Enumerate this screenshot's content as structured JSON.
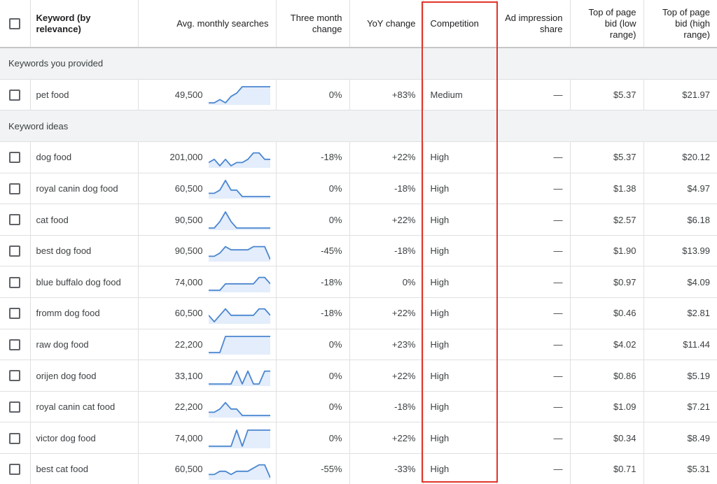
{
  "headers": {
    "keyword": "Keyword (by relevance)",
    "avg": "Avg. monthly searches",
    "three_month": [
      "Three month",
      "change"
    ],
    "yoy": "YoY change",
    "competition": "Competition",
    "impression": [
      "Ad impression",
      "share"
    ],
    "low_bid": [
      "Top of page",
      "bid (low",
      "range)"
    ],
    "high_bid": [
      "Top of page",
      "bid (high",
      "range)"
    ]
  },
  "sections": {
    "provided": "Keywords you provided",
    "ideas": "Keyword ideas"
  },
  "rows": [
    {
      "keyword": "pet food",
      "avg": "49,500",
      "three": "0%",
      "yoy": "+83%",
      "comp": "Medium",
      "imp": "—",
      "low": "$5.37",
      "high": "$21.97",
      "trend": [
        1,
        1,
        2,
        1,
        3,
        4,
        6,
        6,
        6,
        6,
        6,
        6
      ]
    },
    {
      "keyword": "dog food",
      "avg": "201,000",
      "three": "-18%",
      "yoy": "+22%",
      "comp": "High",
      "imp": "—",
      "low": "$5.37",
      "high": "$20.12",
      "trend": [
        2,
        3,
        1,
        3,
        1,
        2,
        2,
        3,
        5,
        5,
        3,
        3
      ]
    },
    {
      "keyword": "royal canin dog food",
      "avg": "60,500",
      "three": "0%",
      "yoy": "-18%",
      "comp": "High",
      "imp": "—",
      "low": "$1.38",
      "high": "$4.97",
      "trend": [
        2,
        2,
        3,
        6,
        3,
        3,
        1,
        1,
        1,
        1,
        1,
        1
      ]
    },
    {
      "keyword": "cat food",
      "avg": "90,500",
      "three": "0%",
      "yoy": "+22%",
      "comp": "High",
      "imp": "—",
      "low": "$2.57",
      "high": "$6.18",
      "trend": [
        1,
        1,
        3,
        6,
        3,
        1,
        1,
        1,
        1,
        1,
        1,
        1
      ]
    },
    {
      "keyword": "best dog food",
      "avg": "90,500",
      "three": "-45%",
      "yoy": "-18%",
      "comp": "High",
      "imp": "—",
      "low": "$1.90",
      "high": "$13.99",
      "trend": [
        2,
        2,
        3,
        5,
        4,
        4,
        4,
        4,
        5,
        5,
        5,
        1
      ]
    },
    {
      "keyword": "blue buffalo dog food",
      "avg": "74,000",
      "three": "-18%",
      "yoy": "0%",
      "comp": "High",
      "imp": "—",
      "low": "$0.97",
      "high": "$4.09",
      "trend": [
        1,
        1,
        1,
        3,
        3,
        3,
        3,
        3,
        3,
        5,
        5,
        3
      ]
    },
    {
      "keyword": "fromm dog food",
      "avg": "60,500",
      "three": "-18%",
      "yoy": "+22%",
      "comp": "High",
      "imp": "—",
      "low": "$0.46",
      "high": "$2.81",
      "trend": [
        3,
        1,
        3,
        5,
        3,
        3,
        3,
        3,
        3,
        5,
        5,
        3
      ]
    },
    {
      "keyword": "raw dog food",
      "avg": "22,200",
      "three": "0%",
      "yoy": "+23%",
      "comp": "High",
      "imp": "—",
      "low": "$4.02",
      "high": "$11.44",
      "trend": [
        1,
        1,
        1,
        6,
        6,
        6,
        6,
        6,
        6,
        6,
        6,
        6
      ]
    },
    {
      "keyword": "orijen dog food",
      "avg": "33,100",
      "three": "0%",
      "yoy": "+22%",
      "comp": "High",
      "imp": "—",
      "low": "$0.86",
      "high": "$5.19",
      "trend": [
        1,
        1,
        1,
        1,
        1,
        5,
        1,
        5,
        1,
        1,
        5,
        5
      ]
    },
    {
      "keyword": "royal canin cat food",
      "avg": "22,200",
      "three": "0%",
      "yoy": "-18%",
      "comp": "High",
      "imp": "—",
      "low": "$1.09",
      "high": "$7.21",
      "trend": [
        2,
        2,
        3,
        5,
        3,
        3,
        1,
        1,
        1,
        1,
        1,
        1
      ]
    },
    {
      "keyword": "victor dog food",
      "avg": "74,000",
      "three": "0%",
      "yoy": "+22%",
      "comp": "High",
      "imp": "—",
      "low": "$0.34",
      "high": "$8.49",
      "trend": [
        1,
        1,
        1,
        1,
        1,
        6,
        1,
        6,
        6,
        6,
        6,
        6
      ]
    },
    {
      "keyword": "best cat food",
      "avg": "60,500",
      "three": "-55%",
      "yoy": "-33%",
      "comp": "High",
      "imp": "—",
      "low": "$0.71",
      "high": "$5.31",
      "trend": [
        2,
        2,
        3,
        3,
        2,
        3,
        3,
        3,
        4,
        5,
        5,
        1
      ]
    }
  ],
  "colors": {
    "sparkline_stroke": "#4a86d0",
    "sparkline_fill": "#e3edfb",
    "highlight": "#e0342a"
  }
}
